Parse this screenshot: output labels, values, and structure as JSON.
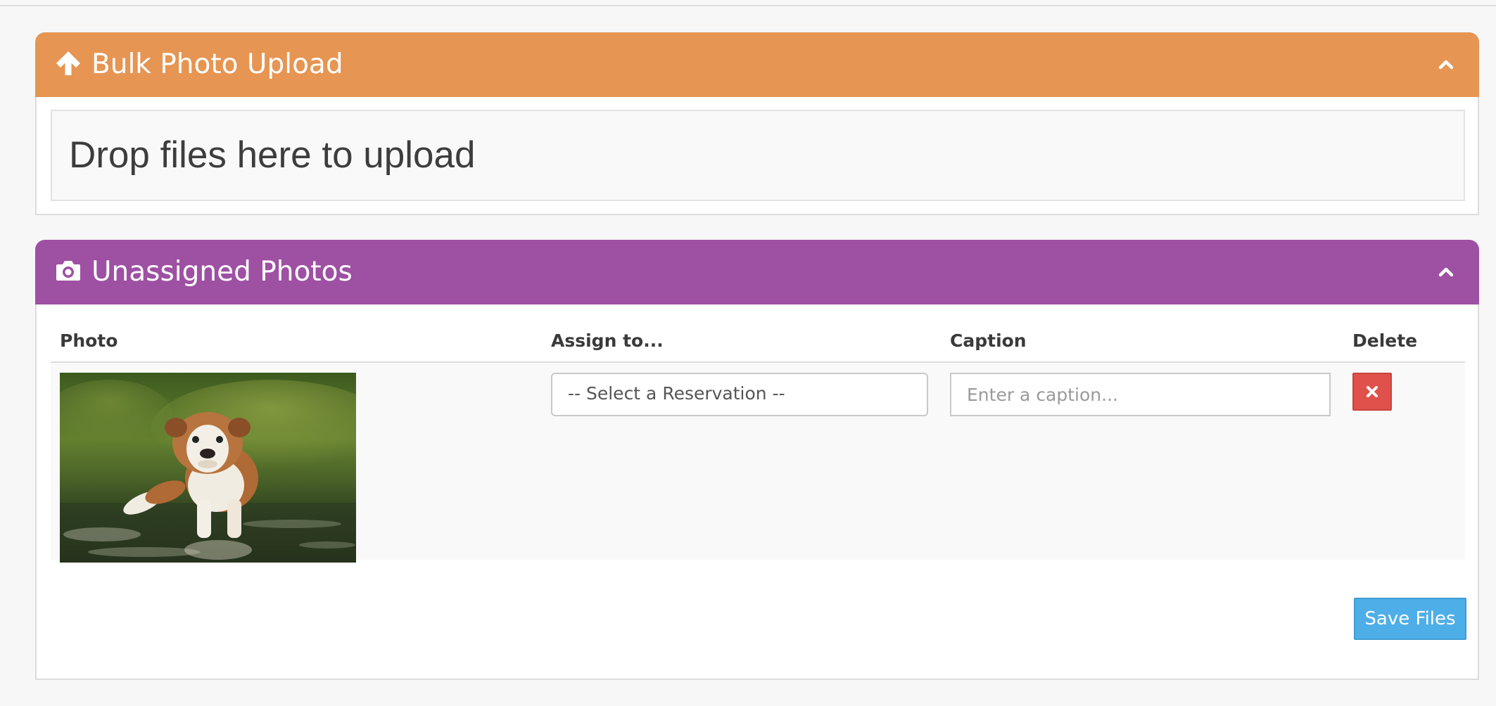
{
  "upload_panel": {
    "title": "Bulk Photo Upload",
    "dropzone_text": "Drop files here to upload",
    "header_color": "#e69552"
  },
  "photos_panel": {
    "title": "Unassigned Photos",
    "header_color": "#9e50a3",
    "columns": {
      "photo": "Photo",
      "assign": "Assign to...",
      "caption": "Caption",
      "delete": "Delete"
    },
    "rows": [
      {
        "reservation_select": "-- Select a Reservation --",
        "caption_value": "",
        "caption_placeholder": "Enter a caption..."
      }
    ],
    "save_label": "Save Files"
  },
  "icons": {
    "upload_heading": "arrow-up-icon",
    "photos_heading": "camera-icon",
    "collapse": "chevron-up-icon",
    "delete": "times-icon"
  },
  "colors": {
    "delete_button": "#e0514b",
    "save_button": "#4eaee8"
  }
}
